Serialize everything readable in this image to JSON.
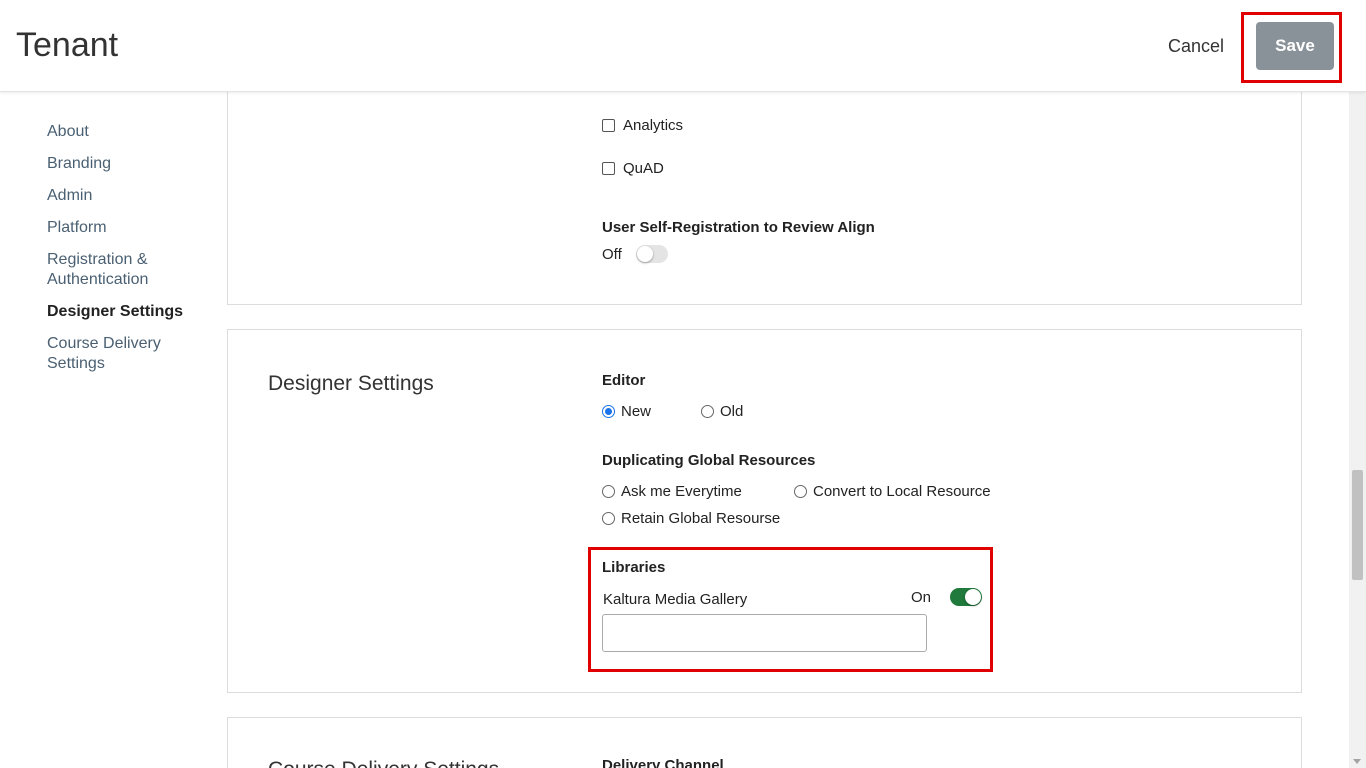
{
  "header": {
    "title": "Tenant",
    "cancel_label": "Cancel",
    "save_label": "Save"
  },
  "sidebar": {
    "items": [
      {
        "label": "About"
      },
      {
        "label": "Branding"
      },
      {
        "label": "Admin"
      },
      {
        "label": "Platform"
      },
      {
        "label": "Registration & Authentication"
      },
      {
        "label": "Designer Settings",
        "active": true
      },
      {
        "label": "Course Delivery Settings"
      }
    ]
  },
  "platform_card": {
    "checkboxes": [
      {
        "label": "Analytics",
        "checked": false
      },
      {
        "label": "QuAD",
        "checked": false
      }
    ],
    "self_registration": {
      "label": "User Self-Registration to Review Align",
      "state_label": "Off",
      "on": false
    }
  },
  "designer_card": {
    "title": "Designer Settings",
    "editor": {
      "label": "Editor",
      "options": [
        {
          "label": "New",
          "selected": true
        },
        {
          "label": "Old",
          "selected": false
        }
      ]
    },
    "duplicating": {
      "label": "Duplicating Global Resources",
      "options": [
        {
          "label": "Ask me Everytime",
          "selected": false
        },
        {
          "label": "Convert to Local Resource",
          "selected": false
        },
        {
          "label": "Retain Global Resourse",
          "selected": false
        }
      ]
    },
    "libraries": {
      "label": "Libraries",
      "item_label": "Kaltura Media Gallery",
      "state_label": "On",
      "on": true,
      "input_value": ""
    }
  },
  "delivery_card": {
    "title": "Course Delivery Settings",
    "channel_label": "Delivery Channel"
  },
  "colors": {
    "highlight": "#e00000",
    "toggle_on": "#1f7a3b",
    "radio_accent": "#1a73e8",
    "save_bg": "#8a9299"
  }
}
